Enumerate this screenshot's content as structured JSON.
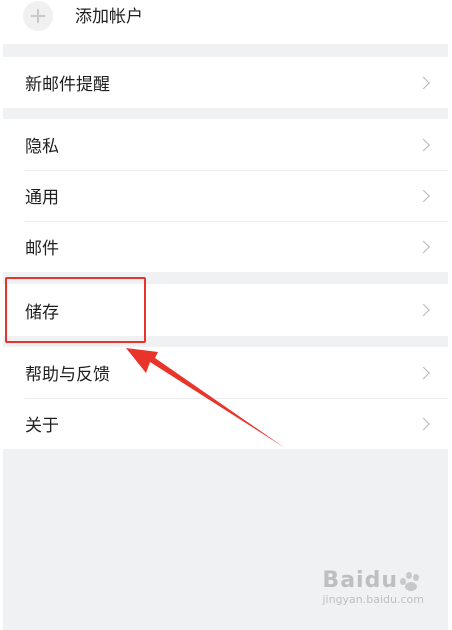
{
  "add_account": {
    "label": "添加帐户"
  },
  "groups": [
    {
      "items": [
        {
          "label": "新邮件提醒"
        }
      ]
    },
    {
      "items": [
        {
          "label": "隐私"
        },
        {
          "label": "通用"
        },
        {
          "label": "邮件"
        }
      ]
    },
    {
      "items": [
        {
          "label": "储存"
        }
      ]
    },
    {
      "items": [
        {
          "label": "帮助与反馈"
        },
        {
          "label": "关于"
        }
      ]
    }
  ],
  "annotation": {
    "color": "#e8342a",
    "target": "储存"
  },
  "watermark": {
    "brand": "Baidu",
    "sub": "jingyan.baidu.com"
  },
  "colors": {
    "background": "#f0f1f3",
    "card": "#ffffff",
    "text": "#1f1f1f",
    "chevron": "#b8b8b8"
  }
}
